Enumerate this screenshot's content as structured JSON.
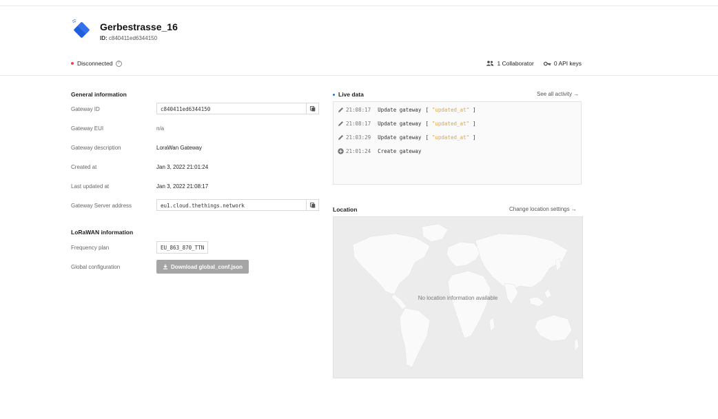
{
  "gateway": {
    "title": "Gerbestrasse_16",
    "id_label": "ID:",
    "id_value": "c840411ed6344150",
    "status": "Disconnected",
    "collaborators": "1 Collaborator",
    "api_keys": "0 API keys"
  },
  "general": {
    "title": "General information",
    "gateway_id_label": "Gateway ID",
    "gateway_id_value": "c840411ed6344150",
    "gateway_eui_label": "Gateway EUI",
    "gateway_eui_value": "n/a",
    "description_label": "Gateway description",
    "description_value": "LoraWan Gateway",
    "created_label": "Created at",
    "created_value": "Jan 3, 2022 21:01:24",
    "updated_label": "Last updated at",
    "updated_value": "Jan 3, 2022 21:08:17",
    "server_label": "Gateway Server address",
    "server_value": "eu1.cloud.thethings.network"
  },
  "lorawan": {
    "title": "LoRaWAN information",
    "freq_label": "Frequency plan",
    "freq_value": "EU_863_870_TTN",
    "global_label": "Global configuration",
    "download_label": "Download global_conf.json"
  },
  "live": {
    "title": "Live data",
    "see_all": "See all activity →",
    "events": [
      {
        "icon": "pencil-icon",
        "time": "21:08:17",
        "name": "Update gateway",
        "open": "[",
        "field": "\"updated_at\"",
        "close": "]"
      },
      {
        "icon": "pencil-icon",
        "time": "21:08:17",
        "name": "Update gateway",
        "open": "[",
        "field": "\"updated_at\"",
        "close": "]"
      },
      {
        "icon": "pencil-icon",
        "time": "21:03:29",
        "name": "Update gateway",
        "open": "[",
        "field": "\"updated_at\"",
        "close": "]"
      },
      {
        "icon": "plus-circle-icon",
        "time": "21:01:24",
        "name": "Create gateway"
      }
    ]
  },
  "location": {
    "title": "Location",
    "change_link": "Change location settings →",
    "empty_text": "No location information available"
  },
  "colors": {
    "status_red": "#e5484d",
    "live_blue": "#1a73e8",
    "string_orange": "#e6a23c",
    "button_gray": "#a5a5a5"
  }
}
